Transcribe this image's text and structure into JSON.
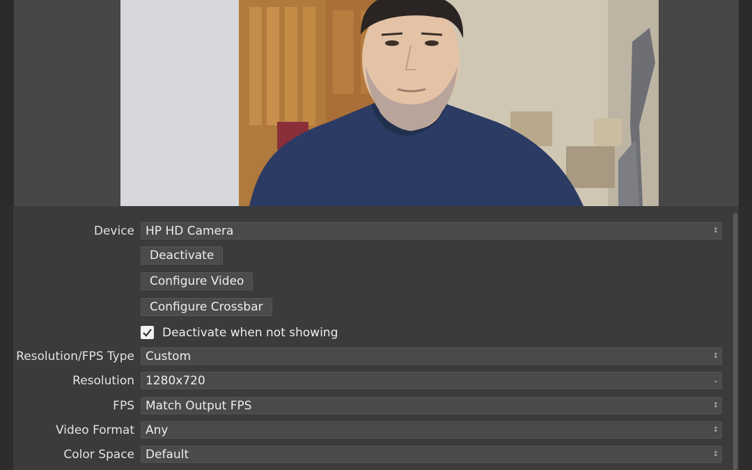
{
  "preview": {
    "source_name": "HP HD Camera"
  },
  "properties": {
    "device": {
      "label": "Device",
      "value": "HP HD Camera"
    },
    "buttons": {
      "deactivate": "Deactivate",
      "configure_video": "Configure Video",
      "configure_crossbar": "Configure Crossbar"
    },
    "deactivate_when_not_showing": {
      "label": "Deactivate when not showing",
      "checked": true
    },
    "resolution_fps_type": {
      "label": "Resolution/FPS Type",
      "value": "Custom"
    },
    "resolution": {
      "label": "Resolution",
      "value": "1280x720"
    },
    "fps": {
      "label": "FPS",
      "value": "Match Output FPS"
    },
    "video_format": {
      "label": "Video Format",
      "value": "Any"
    },
    "color_space": {
      "label": "Color Space",
      "value": "Default"
    }
  },
  "icons": {
    "combo_arrow": "up-down-chevron-icon",
    "dropdown_arrow": "chevron-down-icon",
    "check": "checkmark-icon"
  },
  "colors": {
    "panel_bg": "#3b3b3b",
    "preview_bg": "#474747",
    "control_bg": "#4a4a4a",
    "text": "#e6e6e6"
  }
}
